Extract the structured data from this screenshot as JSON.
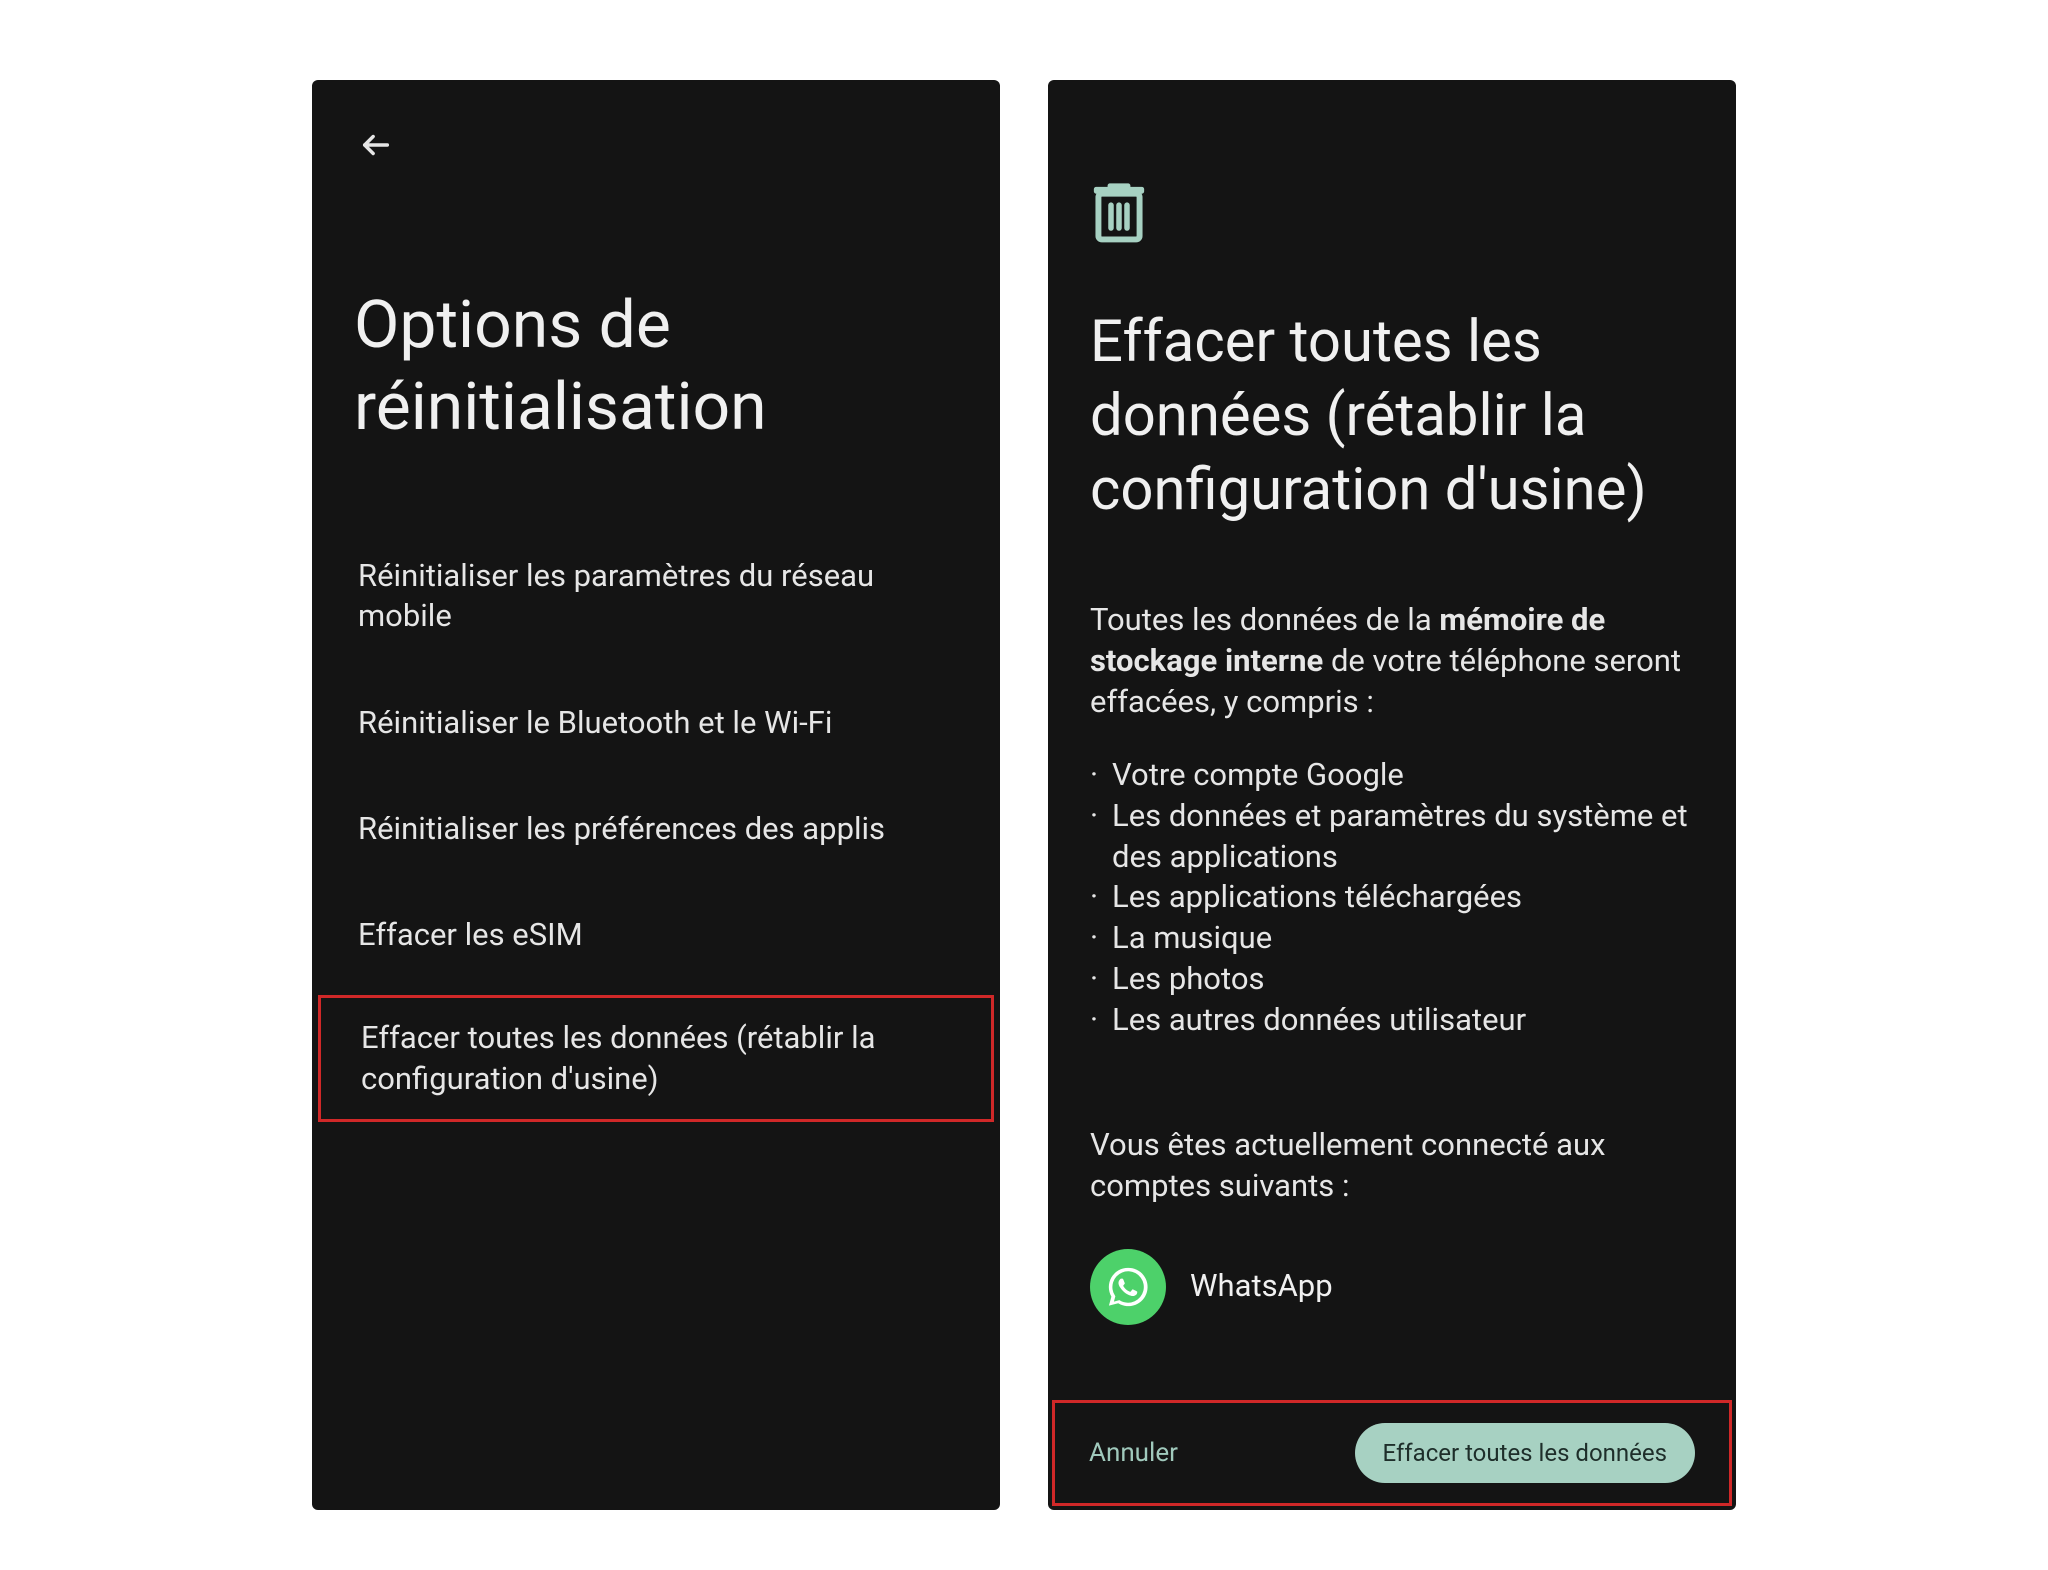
{
  "screen1": {
    "title": "Options de réinitialisation",
    "items": [
      "Réinitialiser les paramètres du réseau mobile",
      "Réinitialiser le Bluetooth et le Wi-Fi",
      "Réinitialiser les préférences des applis",
      "Effacer les eSIM",
      "Effacer toutes les données (rétablir la configuration d'usine)"
    ]
  },
  "screen2": {
    "title": "Effacer toutes les données (rétablir la configuration d'usine)",
    "body_pre": "Toutes les données de la ",
    "body_bold": "mémoire de stockage interne",
    "body_post": " de votre téléphone seront effacées, y compris :",
    "bullets": [
      "Votre compte Google",
      "Les données et paramètres du système et des applications",
      "Les applications téléchargées",
      "La musique",
      "Les photos",
      "Les autres données utilisateur"
    ],
    "accounts_text": "Vous êtes actuellement connecté aux comptes suivants :",
    "account_name": "WhatsApp",
    "cancel_label": "Annuler",
    "confirm_label": "Effacer toutes les données"
  }
}
